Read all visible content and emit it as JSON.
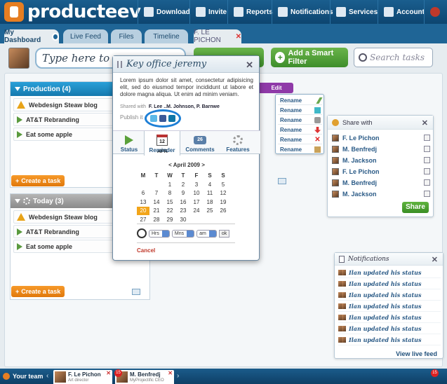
{
  "app": {
    "name": "producteev",
    "accent": "#1a5e8e"
  },
  "topnav": [
    {
      "label": "Download",
      "icon": "download-icon"
    },
    {
      "label": "Invite",
      "icon": "invite-icon"
    },
    {
      "label": "Reports",
      "icon": "reports-icon"
    },
    {
      "label": "Notifications",
      "icon": "notifications-icon"
    },
    {
      "label": "Services",
      "icon": "services-icon"
    },
    {
      "label": "Account",
      "icon": "account-icon"
    }
  ],
  "tabs": [
    {
      "label": "My Dashboard"
    },
    {
      "label": "Live Feed"
    },
    {
      "label": "Files"
    },
    {
      "label": "Timeline"
    },
    {
      "label": "F. LE PICHON"
    }
  ],
  "search": {
    "type_placeholder": "Type here to cre",
    "smart_filter": "Add a Smart Filter",
    "search_placeholder": "Search tasks"
  },
  "lists": [
    {
      "title": "Production (4)",
      "color": "#1d8ec7",
      "tasks": [
        "Webdesign Steaw blog",
        "AT&T Rebranding",
        "Eat some apple"
      ],
      "create": "Create a task"
    },
    {
      "title": "Today (3)",
      "color": "#9a9a9a",
      "tasks": [
        "Webdesign Steaw blog",
        "AT&T Rebranding",
        "Eat some apple"
      ],
      "create": "Create a task"
    }
  ],
  "edit_label": "Edit",
  "rename_items": [
    "Rename",
    "Rename",
    "Rename",
    "Rename",
    "Rename",
    "Rename"
  ],
  "modal": {
    "title": "Key office jeremy",
    "description": "Lorem ipsum dolor sit amet, consectetur adipisicing elit, sed do eiusmod tempor incididunt ut labore et dolore magna aliqua. Ut enim ad minim veniam.",
    "shared_label": "Shared with",
    "shared_names": "F. Lee ..M. Johnson, P. Barnwe",
    "publish_label": "Publish it",
    "tabs": [
      {
        "label": "Status"
      },
      {
        "label": "Reminder",
        "icon_text": "12 APR"
      },
      {
        "label": "Comments",
        "count": "26"
      },
      {
        "label": "Features"
      }
    ],
    "calendar": {
      "month": "< April 2009 >",
      "weekdays": [
        "M",
        "T",
        "W",
        "T",
        "F",
        "S",
        "S"
      ],
      "weeks": [
        [
          "",
          "",
          "1",
          "2",
          "3",
          "4",
          "5"
        ],
        [
          "6",
          "7",
          "8",
          "9",
          "10",
          "11",
          "12"
        ],
        [
          "13",
          "14",
          "15",
          "16",
          "17",
          "18",
          "19"
        ],
        [
          "20",
          "21",
          "22",
          "23",
          "24",
          "25",
          "26"
        ],
        [
          "27",
          "28",
          "29",
          "30",
          "",
          "",
          ""
        ]
      ],
      "selected": "20"
    },
    "time": {
      "hours": "Hrs",
      "minutes": "Mns",
      "ampm": "am",
      "ok": "ok"
    },
    "cancel": "Cancel"
  },
  "share_panel": {
    "title": "Share with",
    "people": [
      "F. Le Pichon",
      "M. Benfredj",
      "M. Jackson",
      "F. Le Pichon",
      "M. Benfredj",
      "M. Jackson"
    ],
    "button": "Share"
  },
  "notifications": {
    "title": "Notifications",
    "items": [
      "Ilan updated his status",
      "Ilan updated his status",
      "Ilan updated his status",
      "Ilan updated his status",
      "Ilan updated his status",
      "Ilan updated his status",
      "Ilan updated his status"
    ],
    "view_live": "View live feed"
  },
  "bottom": {
    "your_team": "Your team",
    "members": [
      {
        "name": "F. Le Pichon",
        "role": "Art director"
      },
      {
        "name": "M. Benfredj",
        "role": "MyProjectific CEO"
      }
    ],
    "badge_left": "15",
    "badge_right": "15"
  }
}
